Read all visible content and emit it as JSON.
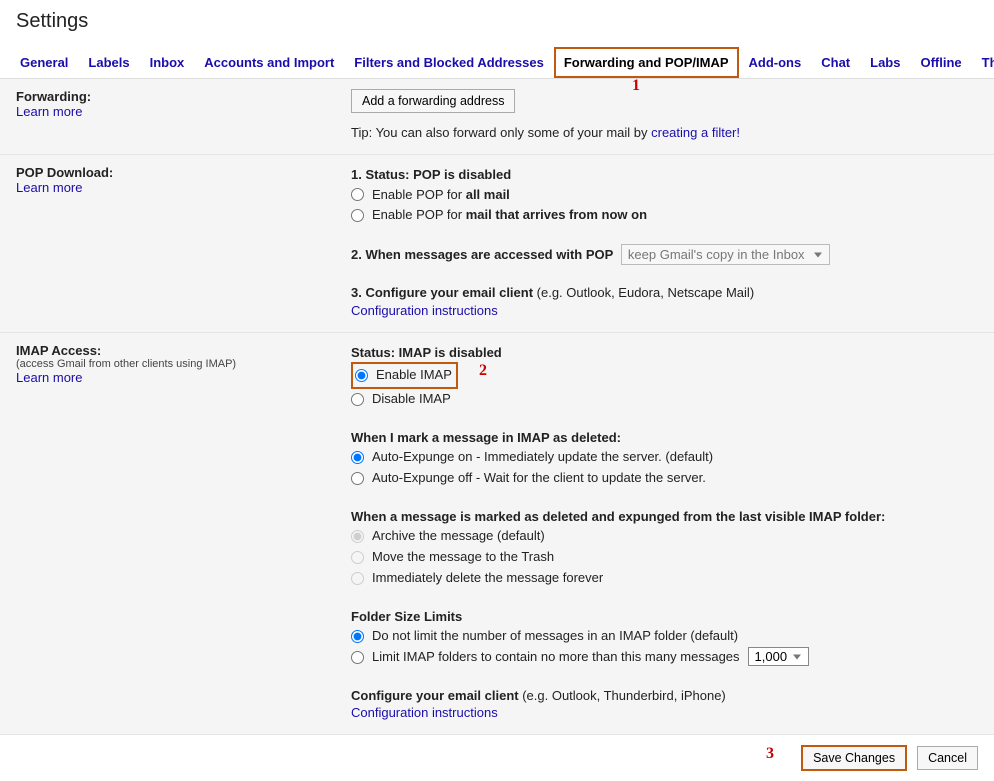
{
  "title": "Settings",
  "tabs": {
    "general": "General",
    "labels": "Labels",
    "inbox": "Inbox",
    "accounts": "Accounts and Import",
    "filters": "Filters and Blocked Addresses",
    "forwarding": "Forwarding and POP/IMAP",
    "addons": "Add-ons",
    "chat": "Chat",
    "labs": "Labs",
    "offline": "Offline",
    "themes": "Themes"
  },
  "annotations": {
    "a1": "1",
    "a2": "2",
    "a3": "3"
  },
  "forwarding": {
    "heading": "Forwarding:",
    "learn": "Learn more",
    "add_btn": "Add a forwarding address",
    "tip_prefix": "Tip: You can also forward only some of your mail by ",
    "tip_link": "creating a filter!"
  },
  "pop": {
    "heading": "POP Download:",
    "learn": "Learn more",
    "status_label": "1. Status: ",
    "status_value": "POP is disabled",
    "enable_all_pre": "Enable POP for ",
    "enable_all_bold": "all mail",
    "enable_now_pre": "Enable POP for ",
    "enable_now_bold": "mail that arrives from now on",
    "accessed_label": "2. When messages are accessed with POP",
    "accessed_value": "keep Gmail's copy in the Inbox",
    "configure_label": "3. Configure your email client ",
    "configure_eg": "(e.g. Outlook, Eudora, Netscape Mail)",
    "config_link": "Configuration instructions"
  },
  "imap": {
    "heading": "IMAP Access:",
    "sub": "(access Gmail from other clients using IMAP)",
    "learn": "Learn more",
    "status_label": "Status: ",
    "status_value": "IMAP is disabled",
    "enable": "Enable IMAP",
    "disable": "Disable IMAP",
    "deleted_heading": "When I mark a message in IMAP as deleted:",
    "expunge_on": "Auto-Expunge on - Immediately update the server. (default)",
    "expunge_off": "Auto-Expunge off - Wait for the client to update the server.",
    "expunged_heading": "When a message is marked as deleted and expunged from the last visible IMAP folder:",
    "archive": "Archive the message (default)",
    "trash": "Move the message to the Trash",
    "delete_forever": "Immediately delete the message forever",
    "folder_heading": "Folder Size Limits",
    "folder_nolimit": "Do not limit the number of messages in an IMAP folder (default)",
    "folder_limit": "Limit IMAP folders to contain no more than this many messages",
    "folder_limit_value": "1,000",
    "configure_label": "Configure your email client ",
    "configure_eg": "(e.g. Outlook, Thunderbird, iPhone)",
    "config_link": "Configuration instructions"
  },
  "footer": {
    "save": "Save Changes",
    "cancel": "Cancel"
  }
}
